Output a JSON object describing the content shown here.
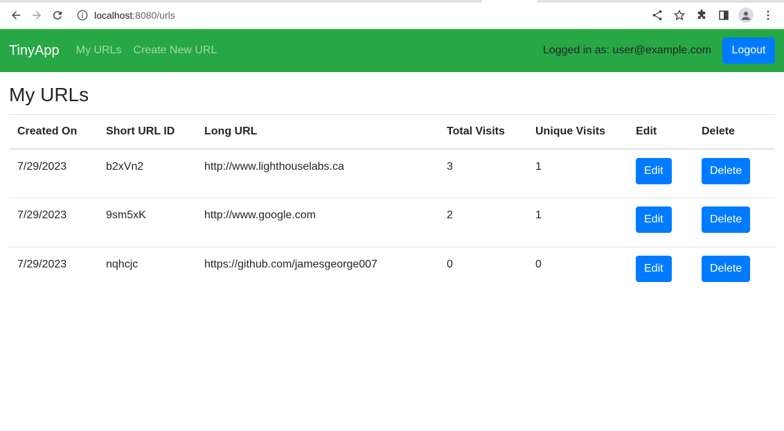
{
  "browser": {
    "url_host": "localhost",
    "url_rest": ":8080/urls"
  },
  "navbar": {
    "brand": "TinyApp",
    "links": [
      "My URLs",
      "Create New URL"
    ],
    "logged_in_text": "Logged in as: user@example.com",
    "logout_label": "Logout",
    "color": "#28a745"
  },
  "page": {
    "title": "My URLs"
  },
  "table": {
    "headers": [
      "Created On",
      "Short URL ID",
      "Long URL",
      "Total Visits",
      "Unique Visits",
      "Edit",
      "Delete"
    ],
    "rows": [
      {
        "created": "7/29/2023",
        "short_id": "b2xVn2",
        "long_url": "http://www.lighthouselabs.ca",
        "total": "3",
        "unique": "1",
        "edit": "Edit",
        "delete": "Delete"
      },
      {
        "created": "7/29/2023",
        "short_id": "9sm5xK",
        "long_url": "http://www.google.com",
        "total": "2",
        "unique": "1",
        "edit": "Edit",
        "delete": "Delete"
      },
      {
        "created": "7/29/2023",
        "short_id": "nqhcjc",
        "long_url": "https://github.com/jamesgeorge007",
        "total": "0",
        "unique": "0",
        "edit": "Edit",
        "delete": "Delete"
      }
    ]
  },
  "colors": {
    "primary_button": "#007bff"
  }
}
